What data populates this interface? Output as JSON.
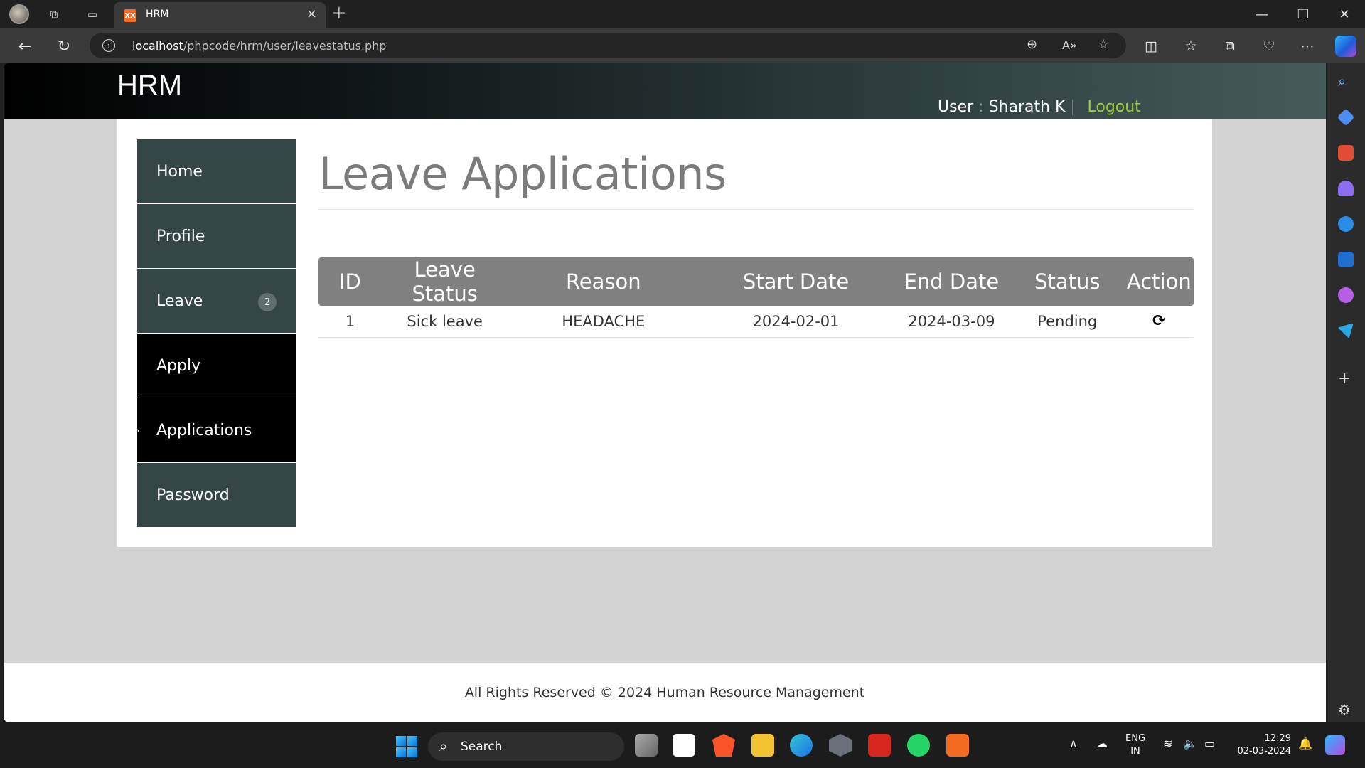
{
  "browser": {
    "tab_title": "HRM",
    "tab_favicon_text": "XX",
    "url_host": "localhost",
    "url_path": "/phpcode/hrm/user/leavestatus.php"
  },
  "site": {
    "logo": "HRM",
    "user_label": "User",
    "user_sep": ":",
    "user_name": "Sharath K",
    "logout_label": "Logout"
  },
  "nav": {
    "items": [
      {
        "label": "Home"
      },
      {
        "label": "Profile"
      },
      {
        "label": "Leave",
        "badge": "2"
      },
      {
        "label": "Apply"
      },
      {
        "label": "Applications",
        "marker": "›"
      },
      {
        "label": "Password"
      }
    ]
  },
  "page": {
    "title": "Leave Applications"
  },
  "table": {
    "headers": [
      "ID",
      "Leave Status",
      "Reason",
      "Start Date",
      "End Date",
      "Status",
      "Action"
    ],
    "rows": [
      {
        "id": "1",
        "leave_status": "Sick leave",
        "reason": "HEADACHE",
        "start_date": "2024-02-01",
        "end_date": "2024-03-09",
        "status": "Pending",
        "action_icon": "refresh-icon"
      }
    ]
  },
  "footer": {
    "text": "All Rights Reserved © 2024 Human Resource Management"
  },
  "taskbar": {
    "search_label": "Search",
    "lang_line1": "ENG",
    "lang_line2": "IN",
    "time": "12:29",
    "date": "02-03-2024"
  },
  "colors": {
    "nav_bg": "#344646",
    "nav_active_bg": "#000000",
    "table_header_bg": "#808080",
    "logout": "#9fc93c",
    "page_bg": "#d3d3d3"
  }
}
